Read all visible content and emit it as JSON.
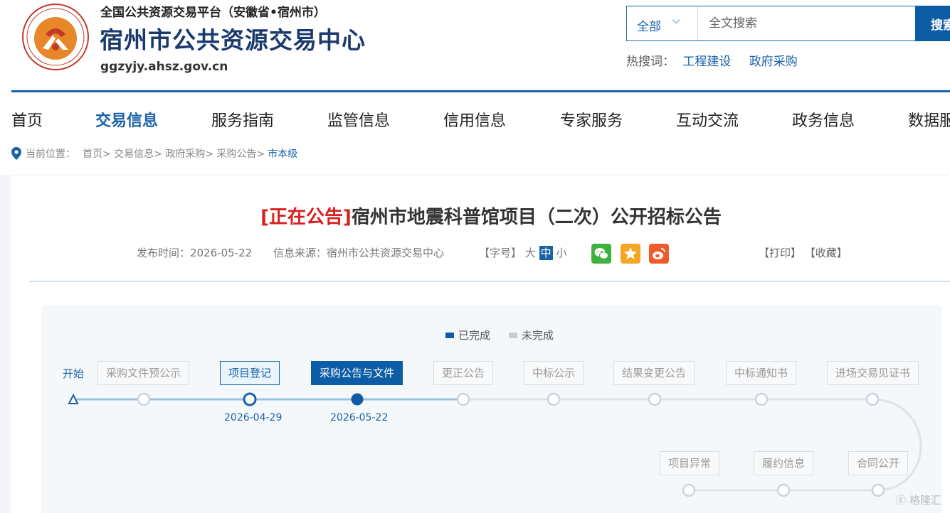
{
  "header": {
    "platform": "全国公共资源交易平台（安徽省•宿州市）",
    "site_title": "宿州市公共资源交易中心",
    "domain": "ggzyjy.ahsz.gov.cn",
    "logo_icon": "public-resource-seal-logo",
    "search": {
      "scope": "全部",
      "placeholder": "全文搜索",
      "button": "搜索"
    },
    "hot_label": "热搜词：",
    "hot_words": [
      "工程建设",
      "政府采购"
    ]
  },
  "nav": {
    "items": [
      "首页",
      "交易信息",
      "服务指南",
      "监管信息",
      "信用信息",
      "专家服务",
      "互动交流",
      "政务信息",
      "数据服务"
    ],
    "active": "交易信息"
  },
  "breadcrumb": {
    "label": "当前位置：",
    "path": "首页> 交易信息> 政府采购> 采购公告>",
    "current": "市本级"
  },
  "article": {
    "tag": "[正在公告]",
    "title": "宿州市地震科普馆项目（二次）公开招标公告",
    "publish": "发布时间：2026-05-22",
    "source": "信息来源：宿州市公共资源交易中心",
    "font_label": "【字号】",
    "font_sizes": [
      "大",
      "中",
      "小"
    ],
    "font_current": "中",
    "share_icons": [
      "wechat-icon",
      "favorite-star-icon",
      "weibo-icon"
    ],
    "print": "【打印】",
    "collect": "【收藏】"
  },
  "flow": {
    "legend": {
      "done": "已完成",
      "todo": "未完成"
    },
    "start": "开始",
    "steps_row1": [
      {
        "label": "采购文件预公示",
        "state": "todo",
        "date": ""
      },
      {
        "label": "项目登记",
        "state": "done",
        "date": "2026-04-29"
      },
      {
        "label": "采购公告与文件",
        "state": "current",
        "date": "2026-05-22"
      },
      {
        "label": "更正公告",
        "state": "todo",
        "date": ""
      },
      {
        "label": "中标公示",
        "state": "todo",
        "date": ""
      },
      {
        "label": "结果变更公告",
        "state": "todo",
        "date": ""
      },
      {
        "label": "中标通知书",
        "state": "todo",
        "date": ""
      },
      {
        "label": "进场交易见证书",
        "state": "todo",
        "date": ""
      }
    ],
    "steps_row2": [
      {
        "label": "项目异常",
        "state": "todo"
      },
      {
        "label": "履约信息",
        "state": "todo"
      },
      {
        "label": "合同公开",
        "state": "todo"
      }
    ]
  },
  "colors": {
    "brand": "#1a62a8",
    "brand_dark": "#0d5da6",
    "notice_tag": "#d8201e",
    "todo": "#c8ccd2"
  },
  "watermark": "格隆汇"
}
